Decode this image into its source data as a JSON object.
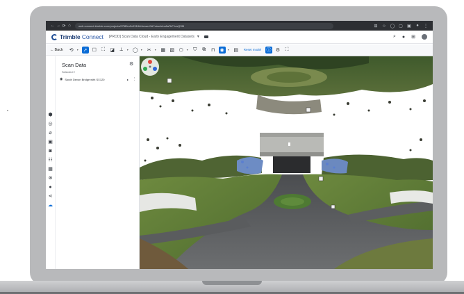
{
  "browser": {
    "url": "web.connect.trimble.com/projects/07f89m2x03184/viewer/3d?viewId=a6a7bF1zsQSM"
  },
  "app": {
    "logo_brand": "Trimble",
    "logo_product": "Connect",
    "project": "[PROD] Scan Data Cloud - Early Engagement Datasets"
  },
  "toolbar": {
    "back_label": "Back",
    "reset_label": "Reset model"
  },
  "panel": {
    "title": "Scan Data",
    "filter": "Selected",
    "item": "South Devon Bridge with SX120"
  },
  "colors": {
    "accent": "#0a6cd6",
    "brand": "#1f4e96",
    "browser_chrome": "#2d2f33"
  }
}
